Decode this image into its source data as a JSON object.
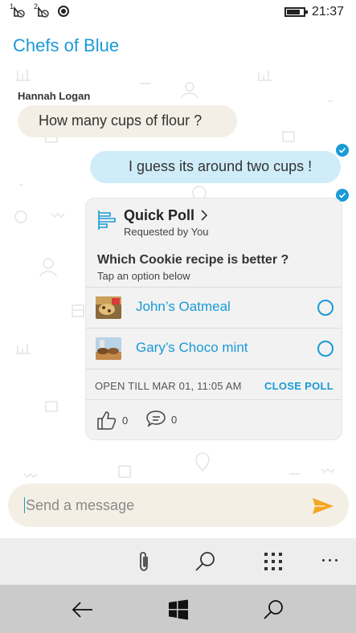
{
  "status_bar": {
    "sim1_label": "1",
    "sim2_label": "2",
    "time": "21:37",
    "battery_level": 0.8
  },
  "header": {
    "title": "Chefs of Blue"
  },
  "messages": [
    {
      "sender": "Hannah Logan",
      "text": "How many cups of flour ?",
      "direction": "incoming"
    },
    {
      "text": "I guess its around two cups !",
      "direction": "outgoing",
      "delivered": true
    }
  ],
  "poll": {
    "title": "Quick Poll",
    "requested_by": "Requested by You",
    "question": "Which Cookie recipe is better ?",
    "hint": "Tap an option below",
    "options": [
      {
        "label": "John’s Oatmeal",
        "thumb_icon": "cookie-photo"
      },
      {
        "label": "Gary’s Choco mint",
        "thumb_icon": "cookie-photo"
      }
    ],
    "open_till": "OPEN TILL MAR 01, 11:05 AM",
    "close_label": "CLOSE POLL",
    "likes": "0",
    "comments": "0"
  },
  "composer": {
    "placeholder": "Send a message",
    "send_icon": "send-icon"
  },
  "app_bar": {
    "icons": [
      "attach-icon",
      "search-icon",
      "apps-grid-icon",
      "more-icon"
    ]
  },
  "nav_bar": {
    "icons": [
      "back-icon",
      "windows-icon",
      "search-icon"
    ]
  },
  "colors": {
    "accent": "#1a9ad6",
    "incoming_bubble": "#f3efe6",
    "outgoing_bubble": "#cfecf9",
    "send": "#f5a623"
  }
}
